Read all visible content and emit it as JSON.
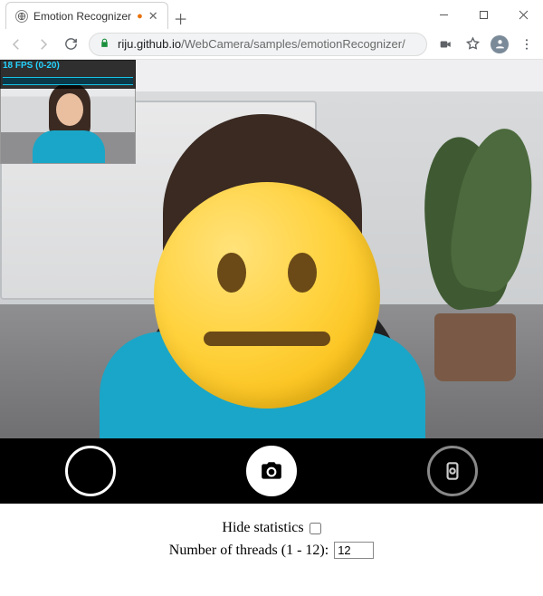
{
  "window": {
    "tab_title": "Emotion Recognizer",
    "tab_icon": "globe-icon",
    "tab_indicator": "●",
    "tab_indicator_color": "#e8710a"
  },
  "toolbar": {
    "url_host": "riju.github.io",
    "url_path": "/WebCamera/samples/emotionRecognizer/"
  },
  "stats": {
    "fps_label": "18 FPS (0-20)"
  },
  "emotion": {
    "detected": "neutral"
  },
  "controls": {
    "hide_stats_label": "Hide statistics",
    "hide_stats_checked": false,
    "threads_label": "Number of threads (1 - 12):",
    "threads_value": "12"
  }
}
